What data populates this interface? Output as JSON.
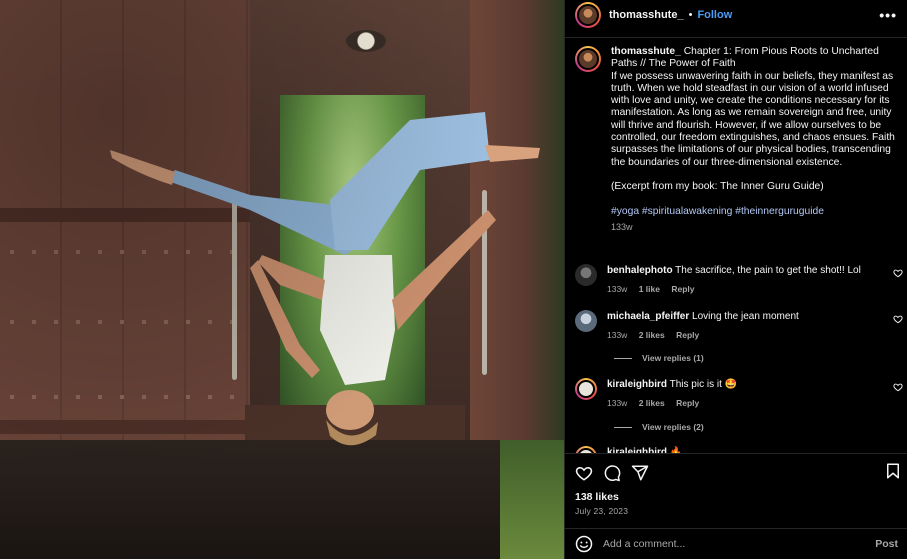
{
  "post": {
    "username": "thomasshute_",
    "dot": "•",
    "follow_label": "Follow",
    "more_label": "•••"
  },
  "caption": {
    "username": "thomasshute_",
    "title": "Chapter 1: From Pious Roots to Uncharted Paths // The Power of Faith",
    "body": "If we possess unwavering faith in our beliefs, they manifest as truth. When we hold steadfast in our vision of a world infused with love and unity, we create the conditions necessary for its manifestation. As long as we remain sovereign and free, unity will thrive and flourish. However, if we allow ourselves to be controlled, our freedom extinguishes, and chaos ensues. Faith surpasses the limitations of our physical bodies, transcending the boundaries of our three-dimensional existence.",
    "excerpt": "(Excerpt from my book: The Inner Guru Guide)",
    "hashtags": "#yoga #spiritualawakening #theinnerguruguide",
    "age": "133w"
  },
  "comments": [
    {
      "username": "benhalephoto",
      "text": "The sacrifice, the pain to get the shot!! Lol",
      "age": "133w",
      "likes": "1 like",
      "reply": "Reply",
      "view_replies": ""
    },
    {
      "username": "michaela_pfeiffer",
      "text": "Loving the jean moment",
      "age": "133w",
      "likes": "2 likes",
      "reply": "Reply",
      "view_replies": "View replies (1)"
    },
    {
      "username": "kiraleighbird",
      "text": "This pic is it 🤩",
      "age": "133w",
      "likes": "2 likes",
      "reply": "Reply",
      "view_replies": "View replies (2)"
    },
    {
      "username": "kiraleighbird",
      "text": "🔥",
      "age": "",
      "likes": "",
      "reply": "",
      "view_replies": ""
    }
  ],
  "actions": {
    "likes": "138 likes",
    "date": "July 23, 2023"
  },
  "add_comment": {
    "placeholder": "Add a comment...",
    "post_label": "Post"
  },
  "colors": {
    "accent": "#4e9cf5",
    "hashtag": "#b2c9f5",
    "muted": "#a8a8a8",
    "background": "#000000"
  }
}
